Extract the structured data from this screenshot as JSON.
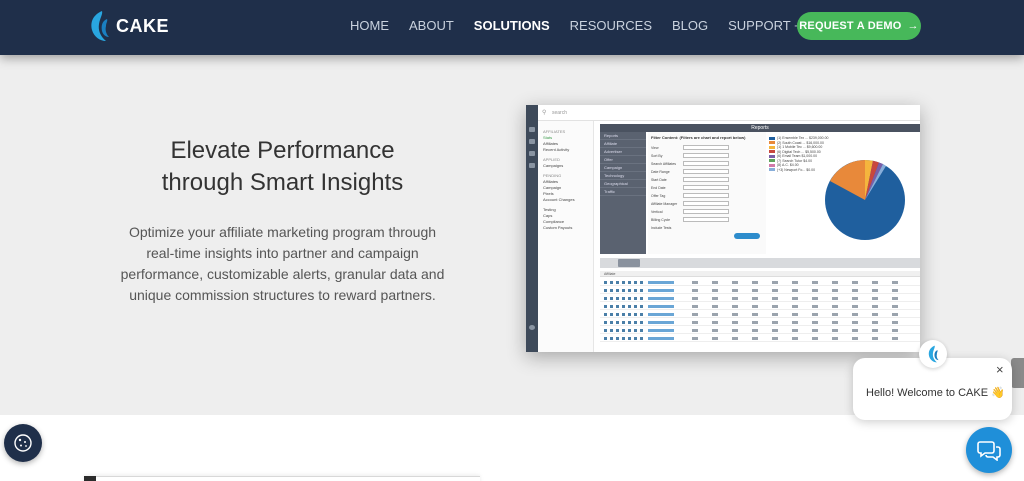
{
  "brand": {
    "name": "CAKE",
    "color": "#1f2f4a",
    "accent": "#1f8fd9"
  },
  "nav": {
    "links": [
      "HOME",
      "ABOUT",
      "SOLUTIONS",
      "RESOURCES",
      "BLOG",
      "SUPPORT + SERVICES"
    ],
    "active": "SOLUTIONS",
    "cta_label": "REQUEST A DEMO",
    "cta_color": "#47b85a"
  },
  "hero": {
    "headline_line1": "Elevate Performance",
    "headline_line2": "through Smart Insights",
    "description": "Optimize your affiliate marketing program through real-time insights into partner and campaign performance, customizable alerts, granular data and unique commission structures to reward partners."
  },
  "screenshot": {
    "search_placeholder": "search",
    "reports_title": "Reports",
    "filter_content_title": "Filter Content: (Filters are chart and report below)",
    "menu": [
      "AFFILIATES",
      "Stats",
      "Affiliates",
      "Recent Activity",
      "APPLIED",
      "Campaigns",
      "PENDING",
      "Affiliates",
      "Campaign",
      "Pixels",
      "Account Changes",
      "Testing",
      "Caps",
      "Compliance",
      "Custom Payouts"
    ],
    "filter_categories": [
      "Reports",
      "Affiliate",
      "Advertiser",
      "Offer",
      "Campaign",
      "Technology",
      "Geographical",
      "Traffic"
    ],
    "form_fields": [
      "View",
      "Sort By",
      "Search Affiliates",
      "Date Range",
      "Start Date",
      "End Date",
      "Offer Tag",
      "Affiliate Manager",
      "Vertical",
      "Billing Cycle",
      "Include Tests"
    ],
    "legend": [
      "(1) Ensemble Tex ... $239,000.00",
      "(2) South Coast ... $16,000.00",
      "(1) 1 Mobile Tec ... $9,600.00",
      "(6) Digital Tech ... $5,500.00",
      "(6) Email Team $1,000.00",
      "(7) Search Tutor $4.00",
      "(8) A.C. $4.00",
      "(+3) Newport Fo... $0.00"
    ],
    "legend_colors": [
      "#1f5f9e",
      "#e8893a",
      "#f5b53d",
      "#c9473e",
      "#7b5ea7",
      "#5fa45c",
      "#d27aa8",
      "#88aeda"
    ],
    "table_header": "Affiliate"
  },
  "cookie": {
    "icon": "cookie-icon"
  },
  "chat": {
    "message": "Hello! Welcome to CAKE 👋",
    "close": "×",
    "launcher_icon": "chat-bubble-icon"
  }
}
